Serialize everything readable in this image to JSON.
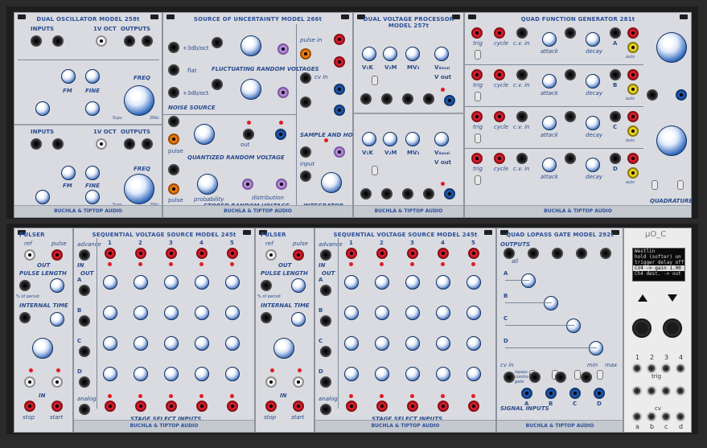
{
  "rack": {
    "top_modules": {
      "dual_oscillator": {
        "title": "DUAL OSCILLATOR MODEL 258t",
        "inputs": "INPUTS",
        "v_oct": "1V OCT",
        "outputs": "OUTPUTS",
        "fm": "FM",
        "fine": "FINE",
        "freq": "FREQ",
        "freq_min": "5cps",
        "freq_max": "20kc",
        "footer": "BUCHLA & TIPTOP AUDIO"
      },
      "source_uncertainty": {
        "title": "SOURCE OF UNCERTAINTY MODEL 266t",
        "noise_labels": [
          "+3db/oct",
          "flat",
          "+3db/oct"
        ],
        "noise_source": "NOISE SOURCE",
        "fluct_title": "FLUCTUATING RANDOM VOLTAGES",
        "quantized_title": "QUANTIZED RANDOM VOLTAGE",
        "stored_title": "STORED RANDOM VOLTAGE",
        "pulse": "pulse",
        "cv": "cv",
        "probability": "probability",
        "distribution": "distribution",
        "out": "out",
        "sample_hold": "SAMPLE AND HOLD",
        "integrator": "INTEGRATOR",
        "input": "input",
        "pulse_in": "pulse in",
        "cv_in": "cv in",
        "footer": "BUCHLA & TIPTOP AUDIO"
      },
      "dual_voltage": {
        "title": "DUAL VOLTAGE PROCESSOR MODEL 257t",
        "labels": [
          "V₁K",
          "V₂M",
          "MV₃",
          "V₄ₛₙₐₗ",
          "V out"
        ],
        "footer": "BUCHLA & TIPTOP AUDIO"
      },
      "quad_function": {
        "title": "QUAD FUNCTION GENERATOR 281t",
        "trig": "trig",
        "cycle": "cycle",
        "cv_in": "c.v. in",
        "attack": "attack",
        "decay": "decay",
        "channels": [
          "A",
          "B",
          "C",
          "D"
        ],
        "outs": "outs",
        "quadrature": "QUADRATURE",
        "footer": "BUCHLA & TIPTOP AUDIO"
      }
    },
    "bottom_modules": {
      "pulser1": {
        "title": "PULSER",
        "ref": "ref",
        "pulse": "pulse",
        "out": "OUT",
        "pulse_length": "PULSE LENGTH",
        "pct_period": "% of period",
        "internal_time": "INTERNAL TIME",
        "in": "IN",
        "stop": "stop",
        "start": "start",
        "footer": "BUCHLA & TIPTOP AUDIO"
      },
      "seq1": {
        "title": "SEQUENTIAL VOLTAGE SOURCE MODEL 245t",
        "advance": "advance",
        "in": "IN",
        "out": "OUT",
        "steps": [
          "1",
          "2",
          "3",
          "4",
          "5"
        ],
        "rows": [
          "A",
          "B",
          "C",
          "D"
        ],
        "analog": "analog",
        "stage_select": "STAGE SELECT INPUTS",
        "footer": "BUCHLA & TIPTOP AUDIO"
      },
      "pulser2": {
        "title": "PULSER",
        "ref": "ref",
        "pulse": "pulse",
        "out": "OUT",
        "pulse_length": "PULSE LENGTH",
        "pct_period": "% of period",
        "internal_time": "INTERNAL TIME",
        "in": "IN",
        "stop": "stop",
        "start": "start",
        "footer": "BUCHLA & TIPTOP AUDIO"
      },
      "seq2": {
        "title": "SEQUENTIAL VOLTAGE SOURCE MODEL 245t",
        "advance": "advance",
        "in": "IN",
        "out": "OUT",
        "steps": [
          "1",
          "2",
          "3",
          "4",
          "5"
        ],
        "rows": [
          "A",
          "B",
          "C",
          "D"
        ],
        "analog": "analog",
        "stage_select": "STAGE SELECT INPUTS",
        "footer": "BUCHLA & TIPTOP AUDIO"
      },
      "lpg": {
        "title": "QUAD LOPASS GATE MODEL 292t",
        "outputs": "OUTPUTS",
        "all": "all",
        "channels": [
          "A",
          "B",
          "C",
          "D"
        ],
        "cv_in": "cv in",
        "min": "min",
        "max": "max",
        "modes": [
          "lopass",
          "combo",
          "gate"
        ],
        "signal_inputs": "SIGNAL INPUTS",
        "footer": "BUCHLA & TIPTOP AUDIO"
      },
      "uo_c": {
        "title": "μO_C",
        "screen_rows": [
          "Westlin",
          "hold (softer)",
          "trigger delay",
          "CV4 -> gain",
          "Ch4 dest. ->"
        ],
        "screen_values": [
          "",
          "on",
          "off",
          "1.00",
          "out"
        ],
        "numbers": [
          "1",
          "2",
          "3",
          "4"
        ],
        "trig": "trig",
        "cv": "cv",
        "letters": [
          "a",
          "b",
          "c",
          "d"
        ]
      }
    }
  }
}
